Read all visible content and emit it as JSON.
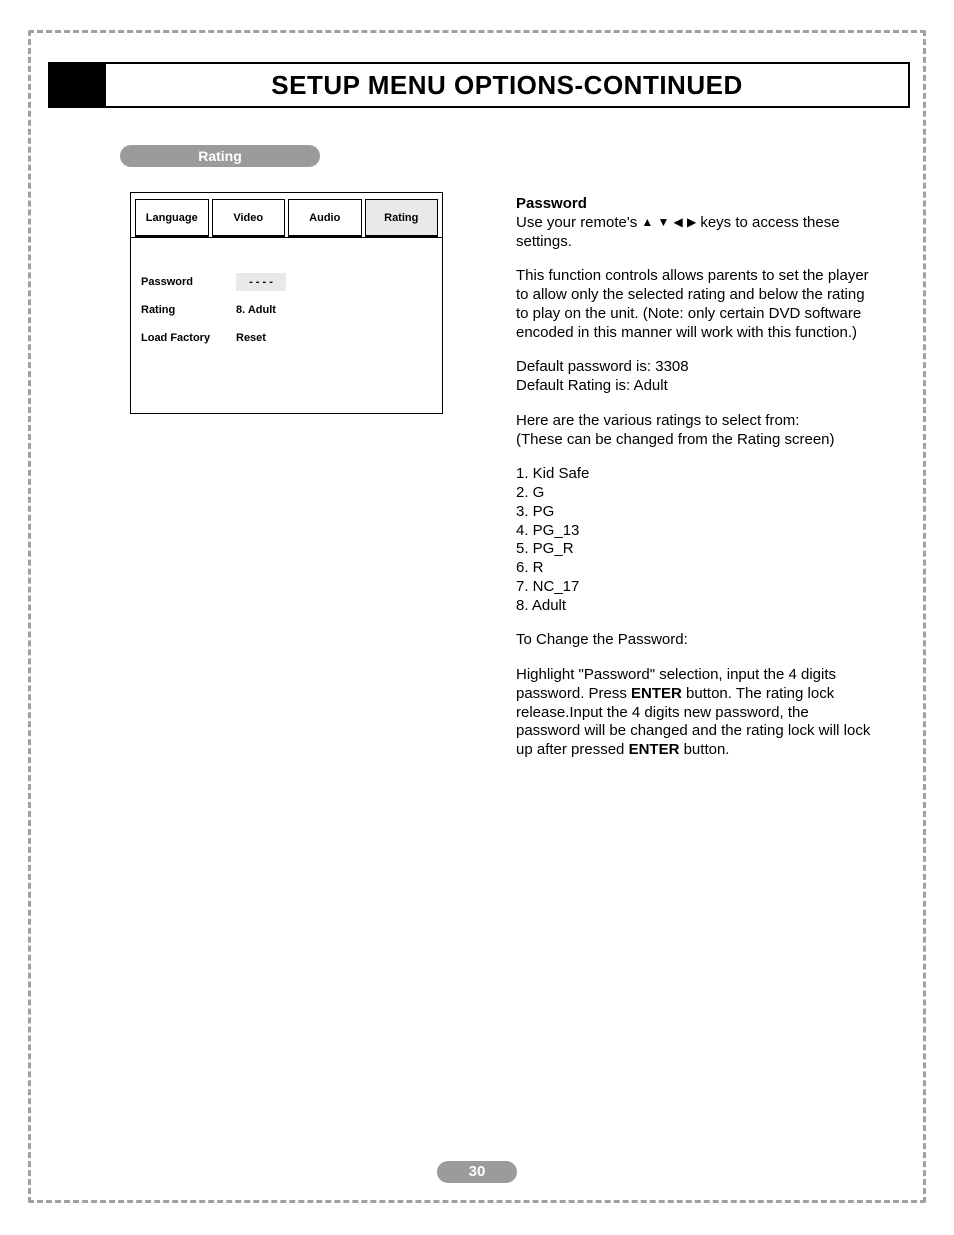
{
  "header": {
    "title": "SETUP MENU OPTIONS-CONTINUED"
  },
  "section_label": "Rating",
  "osd": {
    "tabs": [
      "Language",
      "Video",
      "Audio",
      "Rating"
    ],
    "active_tab_index": 3,
    "rows": [
      {
        "label": "Password",
        "value": "- - - -",
        "boxed": true
      },
      {
        "label": "Rating",
        "value": "8. Adult",
        "boxed": false
      },
      {
        "label": "Load Factory",
        "value": "Reset",
        "boxed": false
      }
    ]
  },
  "body": {
    "h_password": "Password",
    "p1a": "Use your remote's ",
    "p1b": " keys to access these settings.",
    "p2": "This function controls allows parents to set the player to allow only the selected rating and below the rating to play on the unit. (Note: only certain DVD software encoded in this manner will work with this function.)",
    "p3a": "Default password is: 3308",
    "p3b": "Default Rating is: Adult",
    "p4a": "Here are the various ratings to select from:",
    "p4b": "(These can be changed from the Rating screen)",
    "ratings": [
      "1. Kid Safe",
      "2. G",
      "3. PG",
      "4. PG_13",
      "5. PG_R",
      "6. R",
      "7. NC_17",
      "8. Adult"
    ],
    "p5": "To Change the Password:",
    "p6a": "Highlight \"Password\" selection, input the 4 digits password. Press ",
    "p6b": "ENTER",
    "p6c": " button. The rating lock release.Input the 4 digits new password, the password will be changed and the rating lock will lock up after pressed ",
    "p6d": "ENTER",
    "p6e": " button."
  },
  "page_number": "30"
}
